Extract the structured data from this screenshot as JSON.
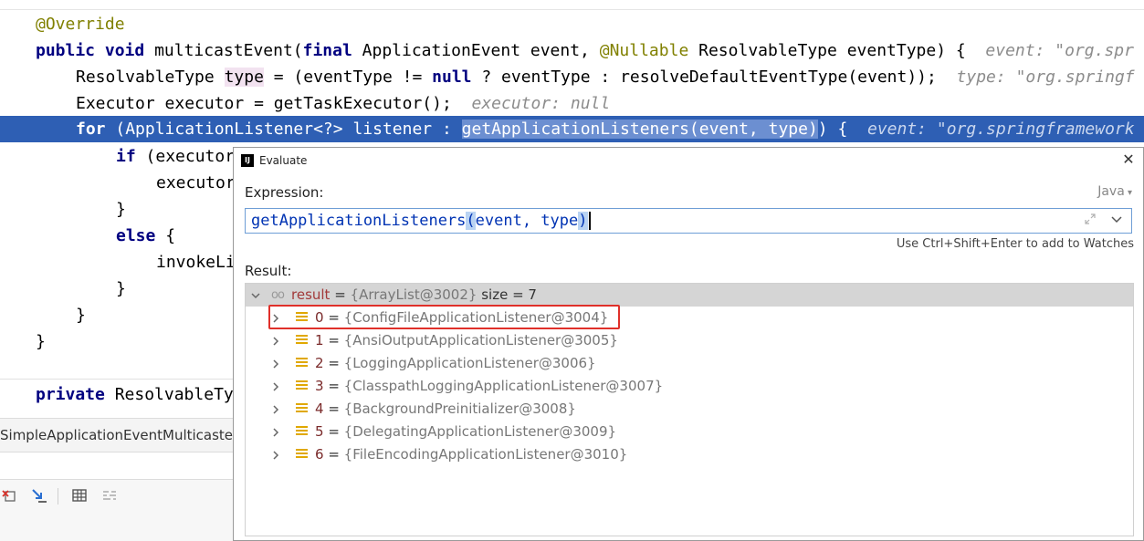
{
  "editor": {
    "line_override": "@Override",
    "line_sig": {
      "kw1": "public",
      "kw2": "void",
      "name": " multicastEvent(",
      "kw3": "final",
      "p1": " ApplicationEvent event, ",
      "ann": "@Nullable",
      "p2": " ResolvableType eventType) {",
      "hint": "event: \"org.spr"
    },
    "line_type": {
      "pre": "ResolvableType ",
      "var": "type",
      "mid1": " = (eventType != ",
      "kw": "null",
      "mid2": " ? eventType : resolveDefaultEventType(event));",
      "hint": "type: \"org.springf"
    },
    "line_exec": {
      "code": "Executor executor = getTaskExecutor();",
      "hint": "executor: null"
    },
    "line_for": {
      "kw": "for",
      "pre": " (ApplicationListener<?> listener : ",
      "sel": "getApplicationListeners(event, type)",
      "post": ") {",
      "hint": "event: \"org.springframework"
    },
    "line_if": {
      "kw": "if",
      "code": " (executor"
    },
    "line_execcall": "executor",
    "brace_close": "}",
    "line_else": {
      "kw": "else",
      "code": " {"
    },
    "line_invoke": "invokeLi",
    "line_private": {
      "kw": "private",
      "code": " ResolvableTy"
    }
  },
  "file_tab": "SimpleApplicationEventMulticaste",
  "toolbar_icons": [
    "step-out-icon",
    "run-to-cursor-icon",
    "evaluate-table-icon",
    "trace-icon"
  ],
  "dialog": {
    "title": "Evaluate",
    "close_glyph": "✕",
    "expression_label": "Expression:",
    "language": "Java",
    "expression": {
      "name": "getApplicationListeners",
      "open": "(",
      "args": "event, type",
      "close": ")"
    },
    "watch_hint": "Use Ctrl+Shift+Enter to add to Watches",
    "result_label": "Result:",
    "result": {
      "name": "result",
      "eq": " = ",
      "value": "{ArrayList@3002}",
      "size": "size = 7"
    },
    "items": [
      {
        "index": "0",
        "value": "{ConfigFileApplicationListener@3004}"
      },
      {
        "index": "1",
        "value": "{AnsiOutputApplicationListener@3005}"
      },
      {
        "index": "2",
        "value": "{LoggingApplicationListener@3006}"
      },
      {
        "index": "3",
        "value": "{ClasspathLoggingApplicationListener@3007}"
      },
      {
        "index": "4",
        "value": "{BackgroundPreinitializer@3008}"
      },
      {
        "index": "5",
        "value": "{DelegatingApplicationListener@3009}"
      },
      {
        "index": "6",
        "value": "{FileEncodingApplicationListener@3010}"
      }
    ]
  },
  "colors": {
    "selection": "#2e5fb4",
    "keyword": "#000080",
    "annotation": "#808000",
    "highlight_box": "#e0302a",
    "field_icon": "#e0a800"
  }
}
